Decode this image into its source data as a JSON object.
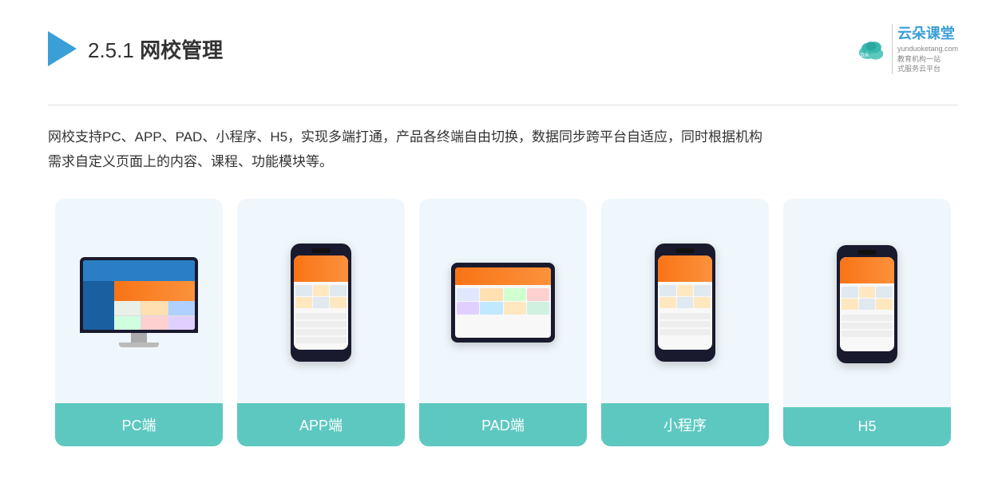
{
  "header": {
    "section_prefix": "2.5.1 ",
    "section_title": "网校管理",
    "brand": {
      "name": "云朵课堂",
      "website": "yunduoketang.com",
      "tagline_line1": "教育机构一站",
      "tagline_line2": "式服务云平台"
    }
  },
  "description": {
    "text_line1": "网校支持PC、APP、PAD、小程序、H5，实现多端打通，产品各终端自由切换，数据同步跨平台自适应，同时根据机构",
    "text_line2": "需求自定义页面上的内容、课程、功能模块等。"
  },
  "cards": [
    {
      "id": "pc",
      "label": "PC端"
    },
    {
      "id": "app",
      "label": "APP端"
    },
    {
      "id": "pad",
      "label": "PAD端"
    },
    {
      "id": "miniapp",
      "label": "小程序"
    },
    {
      "id": "h5",
      "label": "H5"
    }
  ],
  "colors": {
    "accent": "#5dc8c0",
    "header_blue": "#3a9fd6",
    "triangle": "#3a9fd6",
    "text_dark": "#333333",
    "bg_card": "#f0f7fc"
  }
}
